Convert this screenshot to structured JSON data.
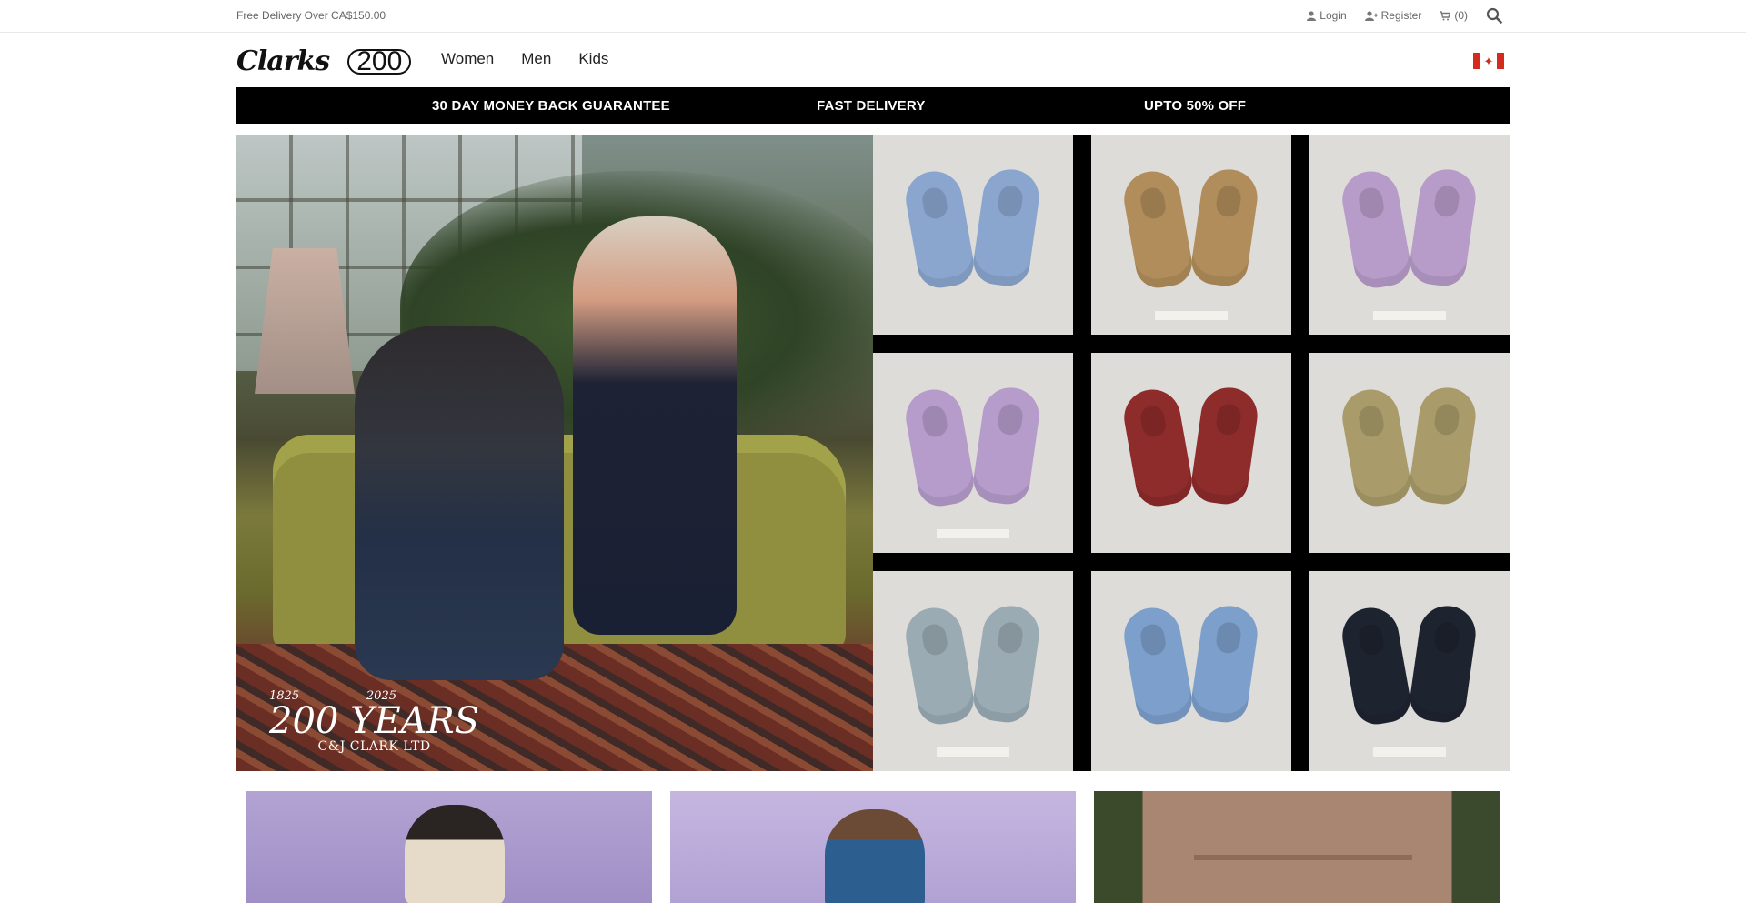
{
  "topbar": {
    "promo": "Free Delivery Over CA$150.00",
    "login": "Login",
    "register": "Register",
    "cart": "(0)"
  },
  "header": {
    "logo_script": "Clarks",
    "logo_number": "200",
    "nav": [
      "Women",
      "Men",
      "Kids"
    ],
    "country": "Canada"
  },
  "usp": {
    "items": [
      "30 DAY MONEY BACK GUARANTEE",
      "FAST DELIVERY",
      "UPTO 50% OFF"
    ]
  },
  "hero": {
    "years_start": "1825",
    "years_end": "2025",
    "years_title": "200 YEARS",
    "years_company": "C&J CLARK LTD",
    "shoe_colors": [
      "#8aa6cf",
      "#b08d5a",
      "#b79cc9",
      "#b69ccb",
      "#8e2b2b",
      "#a99b6a",
      "#9aabb4",
      "#7c9fcb",
      "#1e2330"
    ]
  },
  "colors": {
    "accent": "#000000",
    "text": "#222222",
    "muted": "#666666"
  }
}
